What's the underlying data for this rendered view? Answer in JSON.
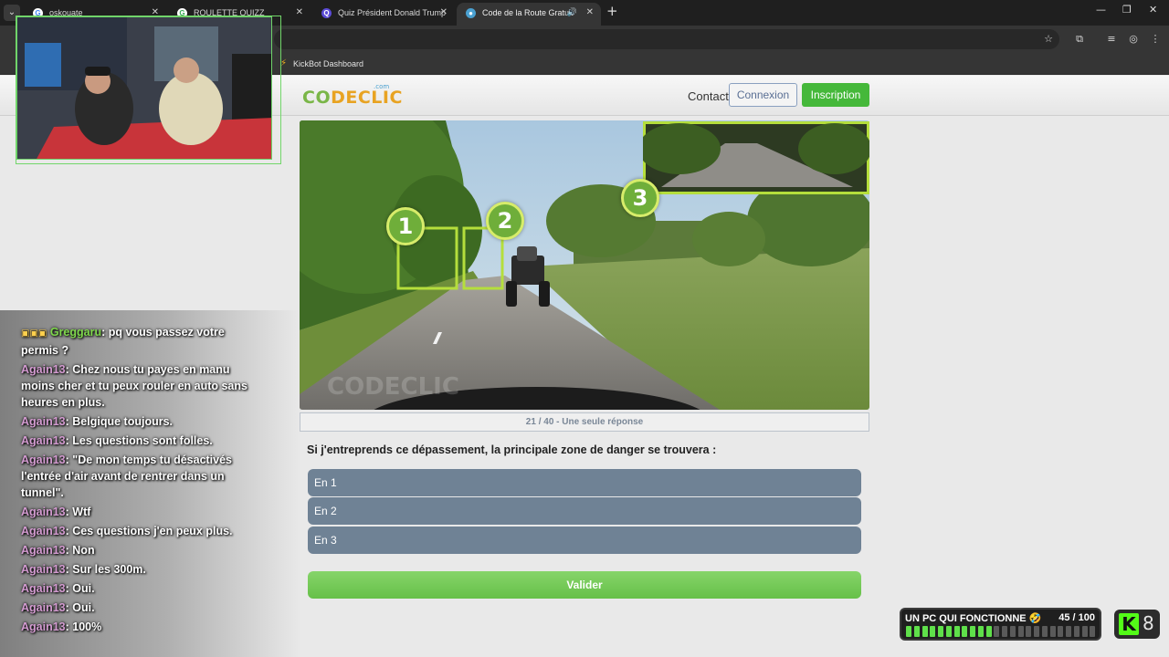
{
  "browser": {
    "tabs": [
      {
        "title": "oskouate",
        "active": false
      },
      {
        "title": "ROULETTE QUIZZ",
        "active": false
      },
      {
        "title": "Quiz Président Donald Trump",
        "active": false
      },
      {
        "title": "Code de la Route Gratuit",
        "active": true
      }
    ],
    "bookmark": "KickBot Dashboard",
    "icons": {
      "menu": "chevron-down-icon",
      "close": "close-icon",
      "new_tab": "plus-icon",
      "audio": "speaker-icon"
    }
  },
  "site": {
    "logo_part1": "CO",
    "logo_part2": "DECLIC",
    "logo_tld": ".com",
    "nav_contact": "Contact",
    "btn_login": "Connexion",
    "btn_signup": "Inscription",
    "colors": {
      "accent_green": "#45b83a",
      "answer_bg": "#6f8295",
      "zone_green": "#6fae3a"
    }
  },
  "quiz": {
    "zones": [
      "1",
      "2",
      "3"
    ],
    "progress": "21 / 40 - Une seule réponse",
    "question_index": 21,
    "question_total": 40,
    "question": "Si j'entreprends ce dépassement, la principale zone de danger se trouvera :",
    "answers": [
      "En 1",
      "En 2",
      "En 3"
    ],
    "validate": "Valider"
  },
  "chat": [
    {
      "badges": "▣▣▣",
      "user": "Greggaru",
      "text": "pq vous passez votre permis ?",
      "green": true
    },
    {
      "user": "Again13",
      "text": "Chez nous tu payes en manu moins cher et tu peux rouler en auto sans heures en plus."
    },
    {
      "user": "Again13",
      "text": "Belgique toujours."
    },
    {
      "user": "Again13",
      "text": "Les questions sont folles."
    },
    {
      "user": "Again13",
      "text": "\"De mon temps tu désactivés l'entrée d'air avant de rentrer dans un tunnel\"."
    },
    {
      "user": "Again13",
      "text": "Wtf"
    },
    {
      "user": "Again13",
      "text": "Ces questions j'en peux plus."
    },
    {
      "user": "Again13",
      "text": "Non"
    },
    {
      "user": "Again13",
      "text": "Sur les 300m."
    },
    {
      "user": "Again13",
      "text": "Oui."
    },
    {
      "user": "Again13",
      "text": "Oui."
    },
    {
      "user": "Again13",
      "text": "100%"
    }
  ],
  "goal": {
    "title": "UN PC QUI FONCTIONNE 🤣",
    "count": "45 / 100",
    "value": 45,
    "max": 100
  },
  "kick": {
    "count": "8"
  }
}
